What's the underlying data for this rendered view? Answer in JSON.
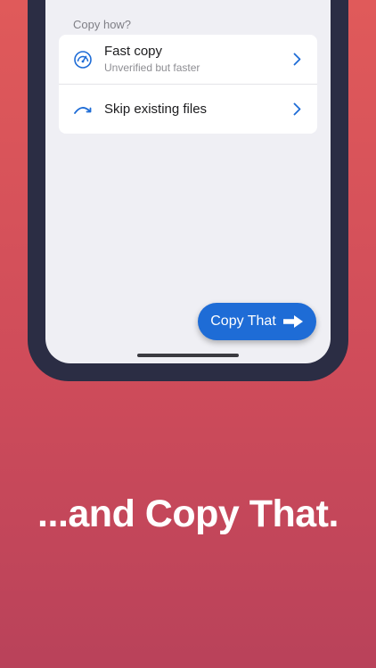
{
  "section": {
    "label": "Copy how?"
  },
  "options": [
    {
      "title": "Fast copy",
      "subtitle": "Unverified but faster",
      "icon": "speedometer-icon"
    },
    {
      "title": "Skip existing files",
      "subtitle": "",
      "icon": "skip-arc-icon"
    }
  ],
  "action_button": {
    "label": "Copy That",
    "icon": "arrow-right-icon"
  },
  "tagline": "...and Copy That.",
  "colors": {
    "accent": "#1e6cd6",
    "background_top": "#e05a5a",
    "background_bottom": "#b9425a",
    "phone_frame": "#2b2d44",
    "screen_bg": "#efeff4"
  }
}
